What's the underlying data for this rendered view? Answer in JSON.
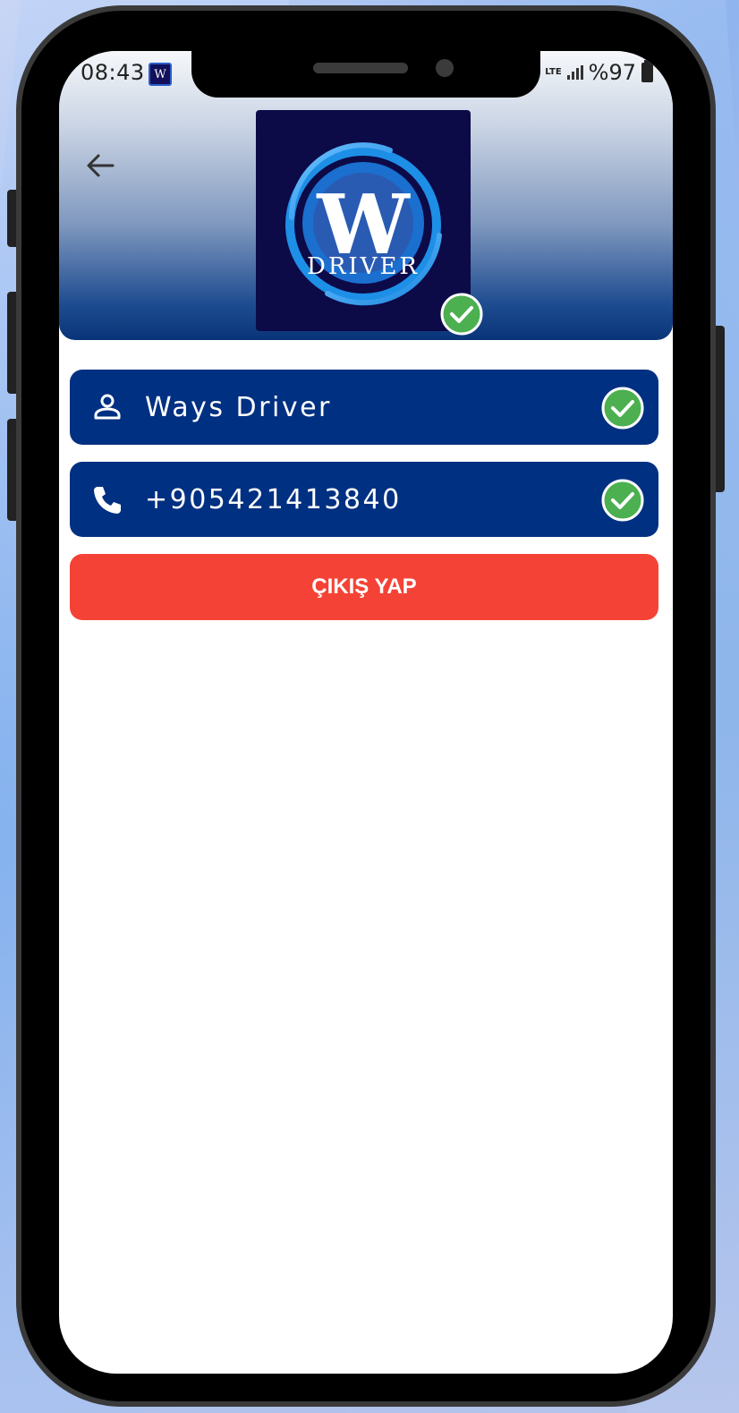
{
  "status_bar": {
    "time": "08:43",
    "app_icon_letter": "W",
    "network": "LTE",
    "battery": "%97"
  },
  "header": {
    "back_icon": "arrow-left-icon",
    "logo_letter": "W",
    "logo_text": "DRIVER",
    "logo_verified": true
  },
  "profile": {
    "name": "Ways Driver",
    "phone": "+905421413840",
    "name_verified": true,
    "phone_verified": true
  },
  "actions": {
    "logout_label": "ÇIKIŞ YAP"
  },
  "colors": {
    "field_bg": "#003081",
    "logout_bg": "#F44336",
    "check_green": "#4CAF50",
    "logo_bg": "#0D0A48"
  }
}
